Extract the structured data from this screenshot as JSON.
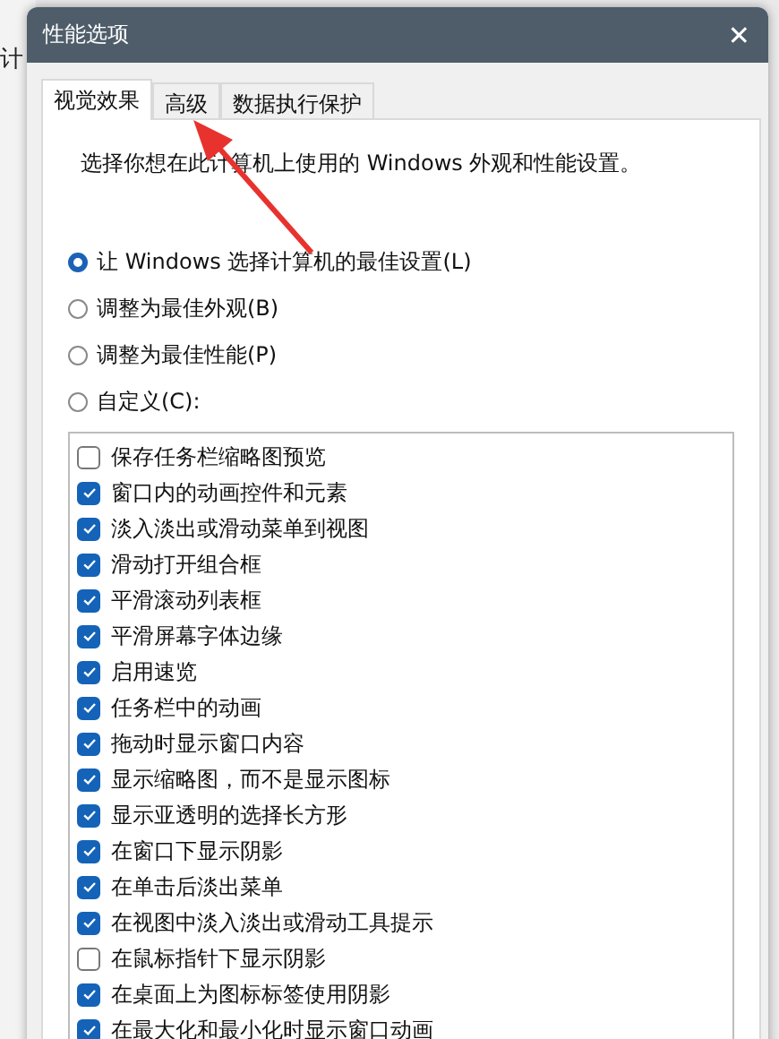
{
  "background_window": {
    "fragments": [
      "计"
    ]
  },
  "window": {
    "title": "性能选项",
    "close": "✕"
  },
  "tabs": [
    {
      "label": "视觉效果",
      "selected": true
    },
    {
      "label": "高级",
      "selected": false
    },
    {
      "label": "数据执行保护",
      "selected": false
    }
  ],
  "description": "选择你想在此计算机上使用的 Windows 外观和性能设置。",
  "options": [
    {
      "label": "让 Windows 选择计算机的最佳设置(L)",
      "selected": true
    },
    {
      "label": "调整为最佳外观(B)",
      "selected": false
    },
    {
      "label": "调整为最佳性能(P)",
      "selected": false
    },
    {
      "label": "自定义(C):",
      "selected": false
    }
  ],
  "effects": [
    {
      "label": "保存任务栏缩略图预览",
      "checked": false
    },
    {
      "label": "窗口内的动画控件和元素",
      "checked": true
    },
    {
      "label": "淡入淡出或滑动菜单到视图",
      "checked": true
    },
    {
      "label": "滑动打开组合框",
      "checked": true
    },
    {
      "label": "平滑滚动列表框",
      "checked": true
    },
    {
      "label": "平滑屏幕字体边缘",
      "checked": true
    },
    {
      "label": "启用速览",
      "checked": true
    },
    {
      "label": "任务栏中的动画",
      "checked": true
    },
    {
      "label": "拖动时显示窗口内容",
      "checked": true
    },
    {
      "label": "显示缩略图，而不是显示图标",
      "checked": true
    },
    {
      "label": "显示亚透明的选择长方形",
      "checked": true
    },
    {
      "label": "在窗口下显示阴影",
      "checked": true
    },
    {
      "label": "在单击后淡出菜单",
      "checked": true
    },
    {
      "label": "在视图中淡入淡出或滑动工具提示",
      "checked": true
    },
    {
      "label": "在鼠标指针下显示阴影",
      "checked": false
    },
    {
      "label": "在桌面上为图标标签使用阴影",
      "checked": true
    },
    {
      "label": "在最大化和最小化时显示窗口动画",
      "checked": true
    }
  ]
}
